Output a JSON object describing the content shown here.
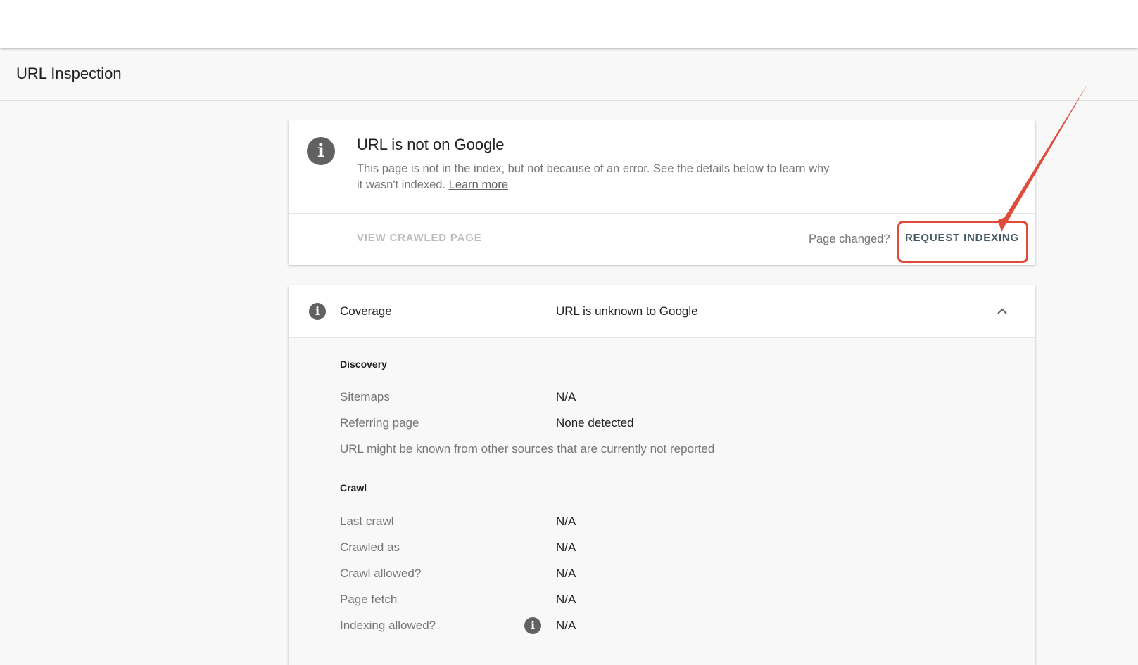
{
  "header": {
    "title": "URL Inspection"
  },
  "status": {
    "title": "URL is not on Google",
    "description": "This page is not in the index, but not because of an error. See the details below to learn why it wasn't indexed.",
    "learn_more": "Learn more",
    "view_crawled": "VIEW CRAWLED PAGE",
    "page_changed": "Page changed?",
    "request_indexing": "REQUEST INDEXING",
    "icon": "info-icon"
  },
  "coverage": {
    "label": "Coverage",
    "value": "URL is unknown to Google",
    "discovery": {
      "title": "Discovery",
      "rows": [
        {
          "label": "Sitemaps",
          "value": "N/A"
        },
        {
          "label": "Referring page",
          "value": "None detected"
        }
      ],
      "note": "URL might be known from other sources that are currently not reported"
    },
    "crawl": {
      "title": "Crawl",
      "rows": [
        {
          "label": "Last crawl",
          "value": "N/A"
        },
        {
          "label": "Crawled as",
          "value": "N/A"
        },
        {
          "label": "Crawl allowed?",
          "value": "N/A"
        },
        {
          "label": "Page fetch",
          "value": "N/A"
        },
        {
          "label": "Indexing allowed?",
          "value": "N/A"
        }
      ]
    }
  },
  "colors": {
    "highlight": "#e04b3c",
    "icon_gray": "#616161",
    "button_text": "#455a64"
  }
}
